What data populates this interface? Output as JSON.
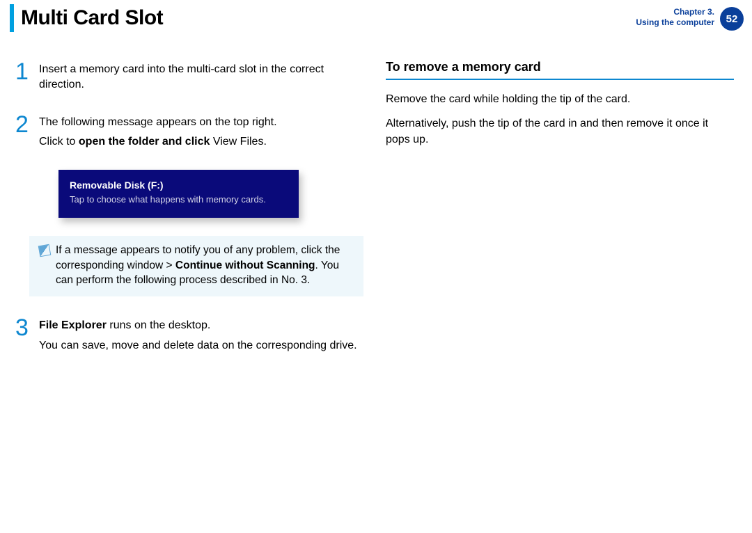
{
  "header": {
    "title": "Multi Card Slot",
    "chapter_line": "Chapter 3.",
    "chapter_sub": "Using the computer",
    "page": "52"
  },
  "left": {
    "step1_num": "1",
    "step1_text": "Insert a memory card into the multi-card slot in the correct direction.",
    "step2_num": "2",
    "step2_line1": "The following message appears on the top right.",
    "step2_line2_pre": "Click to ",
    "step2_line2_bold": "open the folder and click",
    "step2_line2_post": " View Files.",
    "notif_title": "Removable Disk (F:)",
    "notif_body": "Tap to choose what happens with memory cards.",
    "note_pre": "If a message appears to notify you of any problem, click the corresponding window > ",
    "note_bold": "Continue without Scanning",
    "note_post": ". You can perform the following process described in No. 3.",
    "step3_num": "3",
    "step3_line1_bold": "File Explorer",
    "step3_line1_post": " runs on the desktop.",
    "step3_line2": "You can save, move and delete data on the corresponding drive."
  },
  "right": {
    "heading": "To remove a memory card",
    "p1": "Remove the card while holding the tip of the card.",
    "p2": "Alternatively, push the tip of the card in and then remove it once it pops up."
  }
}
